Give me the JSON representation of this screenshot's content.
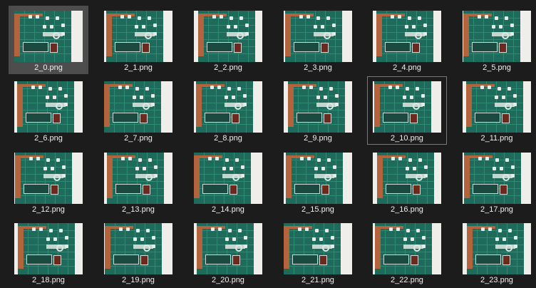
{
  "files": [
    {
      "name": "2_0.png"
    },
    {
      "name": "2_1.png"
    },
    {
      "name": "2_2.png"
    },
    {
      "name": "2_3.png"
    },
    {
      "name": "2_4.png"
    },
    {
      "name": "2_5.png"
    },
    {
      "name": "2_6.png"
    },
    {
      "name": "2_7.png"
    },
    {
      "name": "2_8.png"
    },
    {
      "name": "2_9.png"
    },
    {
      "name": "2_10.png"
    },
    {
      "name": "2_11.png"
    },
    {
      "name": "2_12.png"
    },
    {
      "name": "2_13.png"
    },
    {
      "name": "2_14.png"
    },
    {
      "name": "2_15.png"
    },
    {
      "name": "2_16.png"
    },
    {
      "name": "2_17.png"
    },
    {
      "name": "2_18.png"
    },
    {
      "name": "2_19.png"
    },
    {
      "name": "2_20.png"
    },
    {
      "name": "2_21.png"
    },
    {
      "name": "2_22.png"
    },
    {
      "name": "2_23.png"
    }
  ],
  "selection": {
    "selected_file": "2_0.png",
    "focused_file": "2_10.png"
  },
  "colors": {
    "background": "#1c1c1c",
    "selected": "#4d4d4d",
    "focus_border": "#7a7a7a",
    "caption_text": "#f0f0f0",
    "pcb_green": "#1f6b5b",
    "copper": "#b4643d"
  },
  "icons": {
    "thumbnail": "pcb-photo-thumbnail"
  }
}
